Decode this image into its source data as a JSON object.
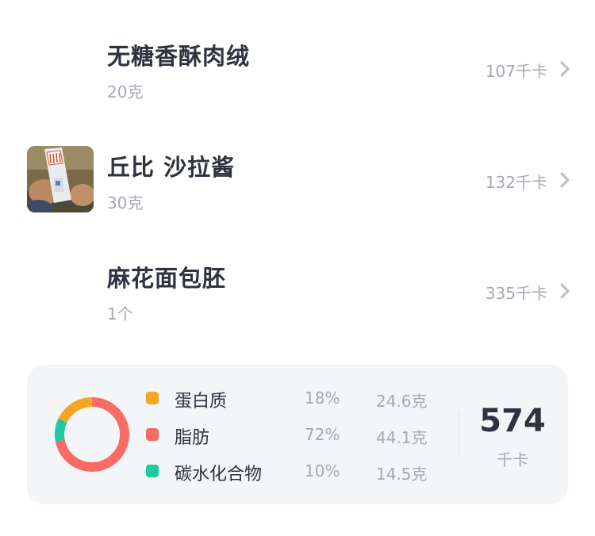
{
  "foods": [
    {
      "name": "无糖香酥肉绒",
      "amount": "20克",
      "kcal": "107千卡",
      "has_image": false
    },
    {
      "name": "丘比 沙拉酱",
      "amount": "30克",
      "kcal": "132千卡",
      "has_image": true
    },
    {
      "name": "麻花面包胚",
      "amount": "1个",
      "kcal": "335千卡",
      "has_image": false
    }
  ],
  "nutrition": {
    "macros": [
      {
        "name": "蛋白质",
        "percent": "18%",
        "grams": "24.6克",
        "share": 0.18,
        "color": "#f5a623"
      },
      {
        "name": "脂肪",
        "percent": "72%",
        "grams": "44.1克",
        "share": 0.72,
        "color": "#f76c63"
      },
      {
        "name": "碳水化合物",
        "percent": "10%",
        "grams": "14.5克",
        "share": 0.1,
        "color": "#1ec9a0"
      }
    ],
    "total": {
      "value": "574",
      "unit": "千卡"
    }
  },
  "icons": {
    "row_chevron": "chevron-right-icon"
  }
}
